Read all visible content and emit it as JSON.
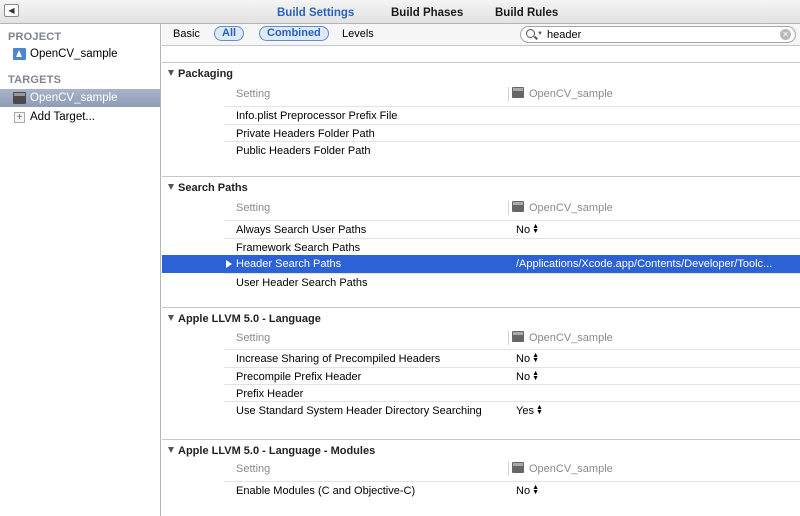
{
  "topbar": {
    "tabs": [
      "Build Settings",
      "Build Phases",
      "Build Rules"
    ],
    "active_tab": "Build Settings"
  },
  "sidebar": {
    "project_header": "PROJECT",
    "project_name": "OpenCV_sample",
    "targets_header": "TARGETS",
    "target_name": "OpenCV_sample",
    "add_target": "Add Target..."
  },
  "filter": {
    "basic": "Basic",
    "all": "All",
    "combined": "Combined",
    "levels": "Levels",
    "search_value": "header"
  },
  "sections": [
    {
      "title": "Packaging",
      "col_setting": "Setting",
      "col_target": "OpenCV_sample",
      "rows": [
        {
          "label": "Info.plist Preprocessor Prefix File",
          "value": ""
        },
        {
          "label": "Private Headers Folder Path",
          "value": ""
        },
        {
          "label": "Public Headers Folder Path",
          "value": ""
        }
      ]
    },
    {
      "title": "Search Paths",
      "col_setting": "Setting",
      "col_target": "OpenCV_sample",
      "rows": [
        {
          "label": "Always Search User Paths",
          "value": "No"
        },
        {
          "label": "Framework Search Paths",
          "value": ""
        },
        {
          "label": "Header Search Paths",
          "value": "/Applications/Xcode.app/Contents/Developer/Toolc..."
        },
        {
          "label": "User Header Search Paths",
          "value": ""
        }
      ]
    },
    {
      "title": "Apple LLVM 5.0 - Language",
      "col_setting": "Setting",
      "col_target": "OpenCV_sample",
      "rows": [
        {
          "label": "Increase Sharing of Precompiled Headers",
          "value": "No"
        },
        {
          "label": "Precompile Prefix Header",
          "value": "No"
        },
        {
          "label": "Prefix Header",
          "value": ""
        },
        {
          "label": "Use Standard System Header Directory Searching",
          "value": "Yes"
        }
      ]
    },
    {
      "title": "Apple LLVM 5.0 - Language - Modules",
      "col_setting": "Setting",
      "col_target": "OpenCV_sample",
      "rows": [
        {
          "label": "Enable Modules (C and Objective-C)",
          "value": "No"
        }
      ]
    }
  ],
  "colors": {
    "selection": "#2d62d6",
    "accent": "#2a62b8",
    "sidebar_selection": "#97a5bd"
  }
}
